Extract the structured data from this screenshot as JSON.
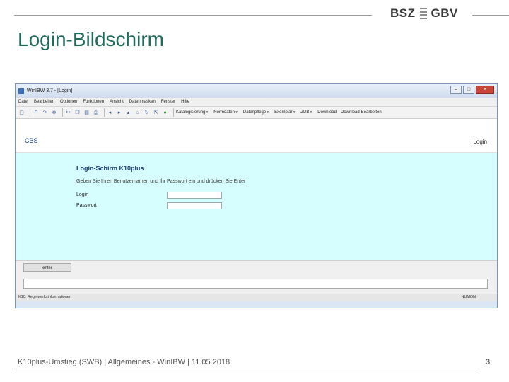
{
  "slide": {
    "title": "Login-Bildschirm",
    "logo_left": "BSZ",
    "logo_right": "GBV",
    "footer": "K10plus-Umstieg (SWB) | Allgemeines - WinIBW | 11.05.2018",
    "page_number": "3"
  },
  "window": {
    "title": "WinIBW 3.7 - [Login]",
    "controls": {
      "minimize": "–",
      "maximize": "□",
      "close": "✕"
    }
  },
  "menu": [
    "Datei",
    "Bearbeiten",
    "Optionen",
    "Funktionen",
    "Ansicht",
    "Datenmasken",
    "Fenster",
    "Hilfe"
  ],
  "toolbar": {
    "icons": [
      "new-icon",
      "undo-icon",
      "redo-icon",
      "stop-icon",
      "cut-icon",
      "copy-icon",
      "paste-icon",
      "print-icon",
      "back-icon",
      "forward-icon",
      "up-icon",
      "home-icon",
      "refresh-icon",
      "export-icon",
      "go-icon"
    ],
    "dropdowns": [
      "Katalogisierung",
      "Normdaten",
      "Datenpflege",
      "Exemplar",
      "ZDB"
    ],
    "buttons": [
      "Download",
      "Download-Bearbeiten"
    ]
  },
  "app": {
    "system": "CBS",
    "mode": "Login",
    "form_title": "Login-Schirm K10plus",
    "instruction": "Geben Sie Ihren Benutzernamen und Ihr Passwort ein und drücken Sie Enter",
    "fields": [
      {
        "label": "Login",
        "value": ""
      },
      {
        "label": "Passwort",
        "value": ""
      }
    ],
    "enter_button": "enter"
  },
  "status": {
    "text": "K10: Regelwerksinformationen",
    "num": "NUM",
    "gn": "GN"
  },
  "colors": {
    "title_green": "#1f6b5c",
    "form_bg": "#d6fdff",
    "heading_blue": "#1a3f7a"
  }
}
